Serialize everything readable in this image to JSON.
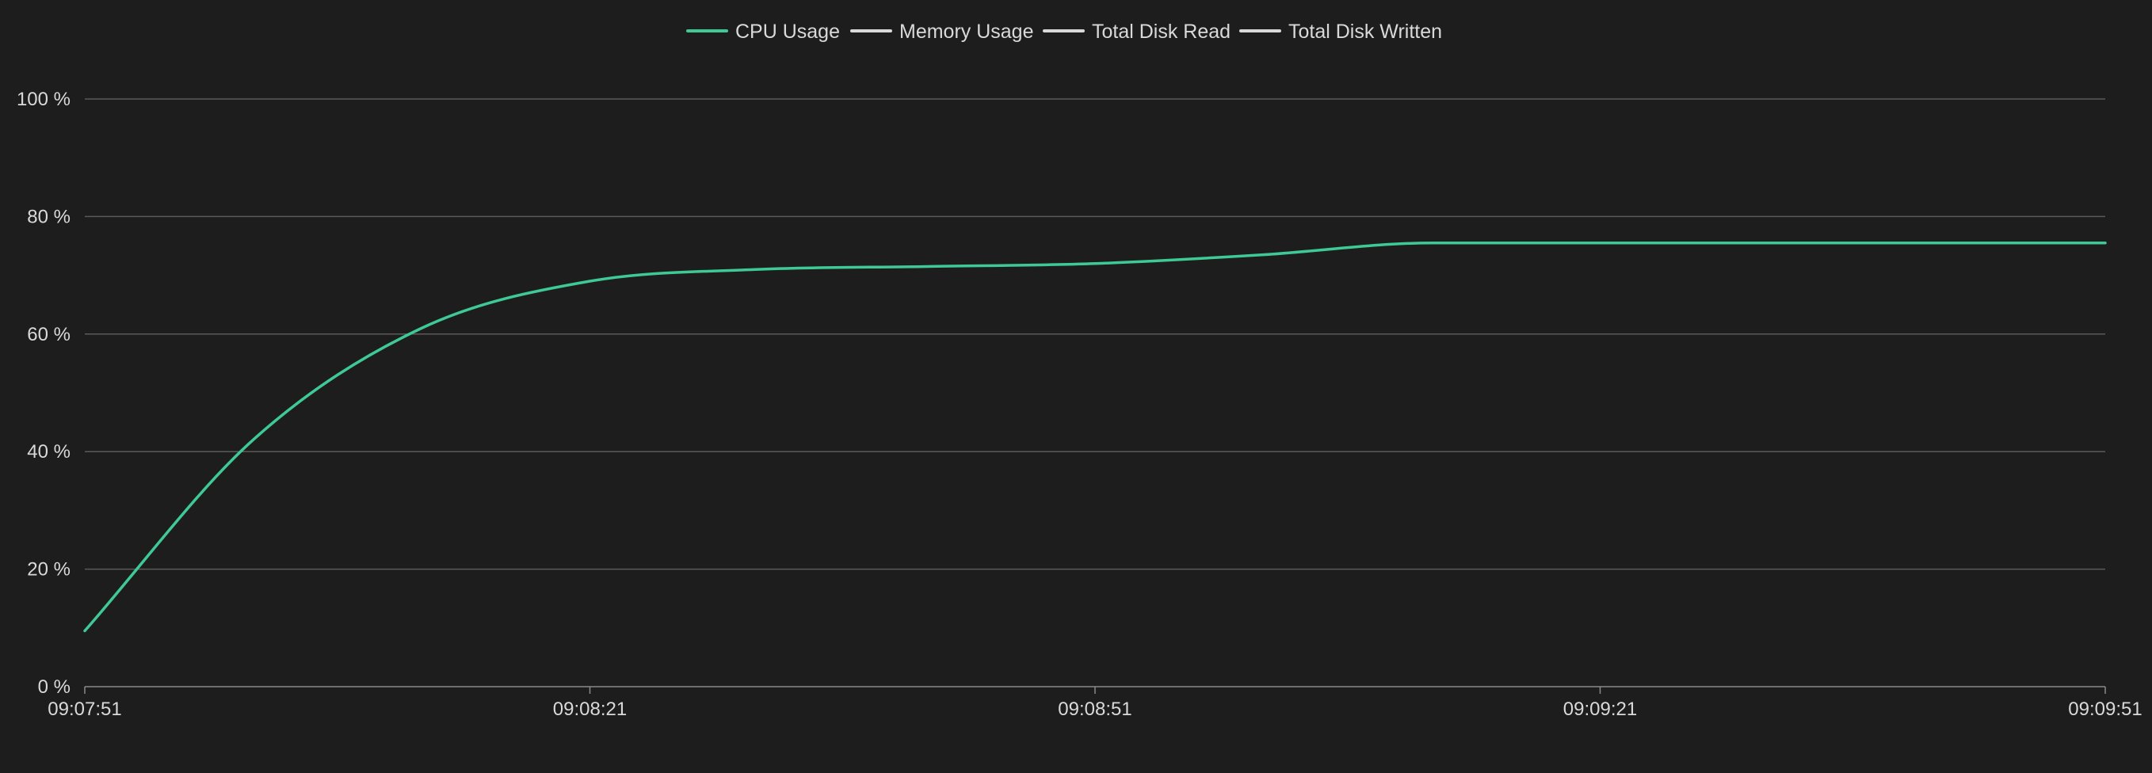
{
  "colors": {
    "background": "#1d1d1d",
    "cpu": "#3ec996",
    "inactive": "#d9d9d9",
    "grid": "#5a5a5a",
    "text": "#d9d9d9"
  },
  "chart_data": {
    "type": "line",
    "title": "",
    "xlabel": "",
    "ylabel": "",
    "ylim": [
      0,
      100
    ],
    "y_ticks": [
      0,
      20,
      40,
      60,
      80,
      100
    ],
    "y_tick_labels": [
      "0 %",
      "20 %",
      "40 %",
      "60 %",
      "80 %",
      "100 %"
    ],
    "xlim": [
      "09:07:51",
      "09:09:51"
    ],
    "x_ticks": [
      "09:07:51",
      "09:08:21",
      "09:08:51",
      "09:09:21",
      "09:09:51"
    ],
    "grid": true,
    "legend_position": "top-center",
    "legend": [
      {
        "name": "CPU Usage",
        "color": "#3ec996",
        "active": true
      },
      {
        "name": "Memory Usage",
        "color": "#d9d9d9",
        "active": false
      },
      {
        "name": "Total Disk Read",
        "color": "#d9d9d9",
        "active": false
      },
      {
        "name": "Total Disk Written",
        "color": "#d9d9d9",
        "active": false
      }
    ],
    "series": [
      {
        "name": "CPU Usage",
        "color": "#3ec996",
        "x": [
          "09:07:51",
          "09:08:01",
          "09:08:11",
          "09:08:21",
          "09:08:31",
          "09:08:41",
          "09:08:51",
          "09:09:01",
          "09:09:11",
          "09:09:21",
          "09:09:31",
          "09:09:41",
          "09:09:51"
        ],
        "values": [
          9.5,
          42,
          61,
          69,
          71,
          71.5,
          72,
          73.5,
          75.5,
          75.5,
          75.5,
          75.5,
          75.5
        ]
      }
    ]
  }
}
